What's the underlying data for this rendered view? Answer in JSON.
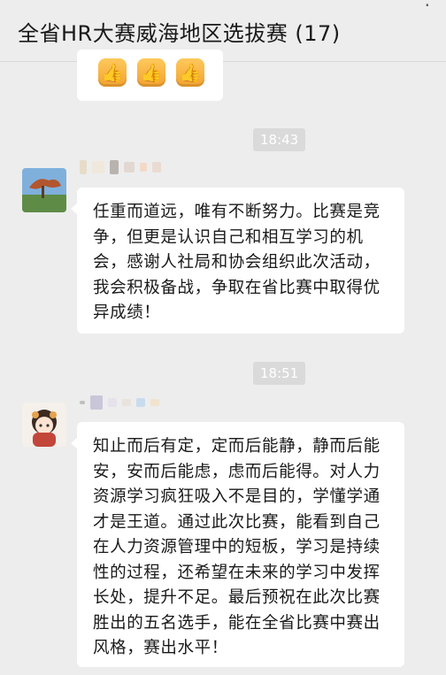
{
  "header": {
    "title": "全省HR大赛威海地区选拔赛 (17)",
    "more_icon": "ellipsis-icon"
  },
  "top_message": {
    "icons": [
      "thumbs-up-icon",
      "thumbs-up-icon",
      "thumbs-up-icon"
    ]
  },
  "messages": [
    {
      "time": "18:43",
      "text": "任重而道远，唯有不断努力。比赛是竞争，但更是认识自己和相互学习的机会，感谢人社局和协会组织此次活动，我会积极备战，争取在省比赛中取得优异成绩！"
    },
    {
      "time": "18:51",
      "text": "知止而后有定，定而后能静，静而后能安，安而后能虑，虑而后能得。对人力资源学习疯狂吸入不是目的，学懂学通才是王道。通过此次比赛，能看到自己在人力资源管理中的短板，学习是持续性的过程，还希望在未来的学习中发挥长处，提升不足。最后预祝在此次比赛胜出的五名选手，能在全省比赛中赛出风格，赛出水平！"
    }
  ],
  "colors": {
    "background": "#ededed",
    "bubble": "#ffffff",
    "timestamp_bg": "#dadada"
  }
}
